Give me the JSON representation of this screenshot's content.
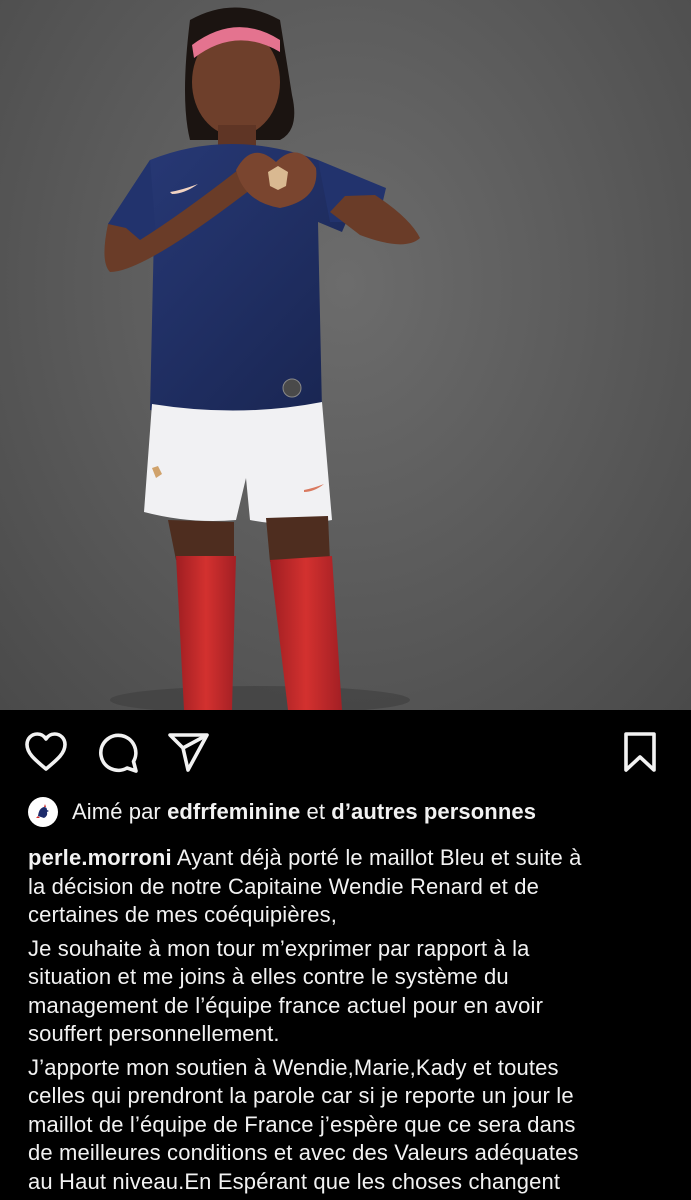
{
  "post": {
    "photo_description_icon": "photo",
    "likes": {
      "prefix": "Aimé par",
      "liker": "edfrfeminine",
      "conjunction": "et",
      "others": "d’autres personnes"
    },
    "caption": {
      "username": "perle.morroni",
      "paragraph1": "Ayant déjà porté le maillot Bleu et suite à\nla décision de notre Capitaine Wendie Renard et de\ncertaines de mes coéquipières,",
      "paragraph2": "Je souhaite à mon tour m’exprimer par rapport à la\nsituation et me joins à elles contre le système du\nmanagement de l’équipe france actuel pour en avoir\nsouffert personnellement.",
      "paragraph3": "J’apporte mon soutien à Wendie,Marie,Kady et toutes\ncelles qui prendront la parole car si je reporte un jour le\nmaillot de l’équipe de France j’espère que ce sera dans\nde meilleures conditions et avec des Valeurs adéquates\nau Haut niveau.En Espérant que les choses changent"
    }
  },
  "icons": {
    "like": "heart-outline-icon",
    "comment": "comment-bubble-icon",
    "share": "paper-plane-icon",
    "save": "bookmark-icon",
    "liker_avatar": "fff-rooster-logo-icon"
  },
  "colors": {
    "background": "#000000",
    "text": "#f2f2f2",
    "jersey_navy": "#1f2e63",
    "shorts_white": "#f1f1f3",
    "socks_red": "#c22a2a",
    "headband_pink": "#e4738f"
  }
}
